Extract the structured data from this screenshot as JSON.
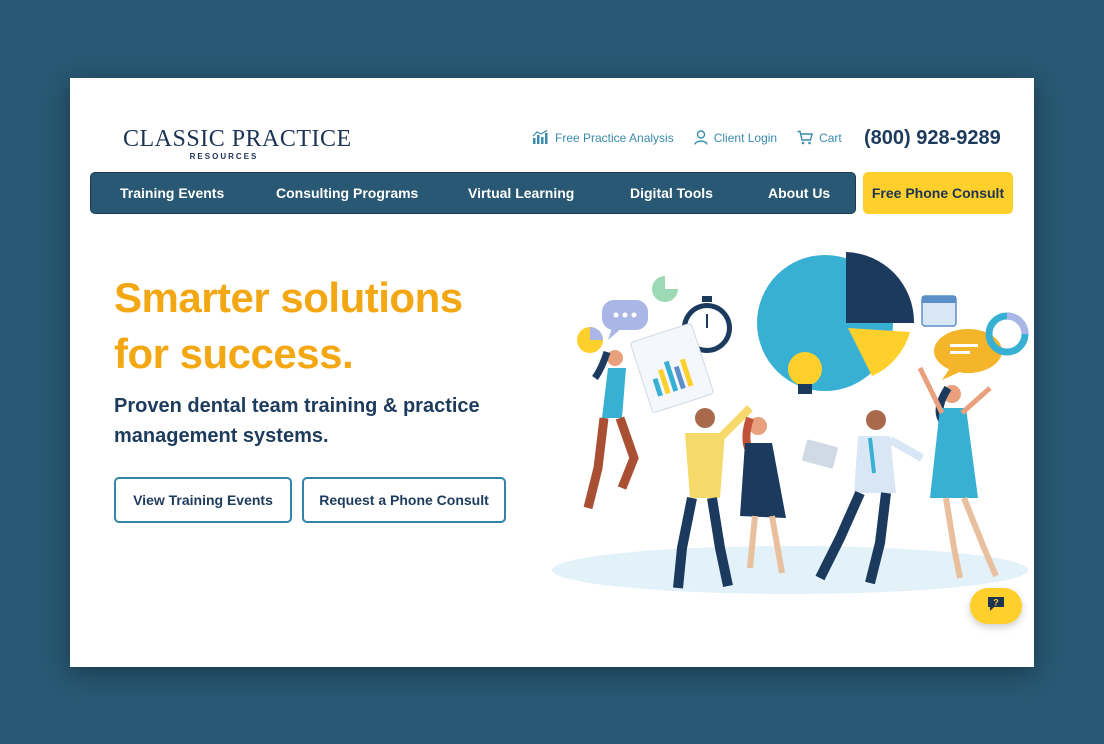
{
  "brand": {
    "name_line1": "CLASSIC PRACTICE",
    "name_line2": "RESOURCES"
  },
  "utility": {
    "analysis": "Free Practice Analysis",
    "login": "Client Login",
    "cart": "Cart",
    "phone": "(800) 928-9289"
  },
  "nav": {
    "items": [
      "Training Events",
      "Consulting Programs",
      "Virtual Learning",
      "Digital Tools",
      "About Us"
    ],
    "cta": "Free Phone Consult"
  },
  "hero": {
    "headline_1": "Smarter solutions",
    "headline_2": "for success.",
    "subhead": "Proven dental team training & practice management systems.",
    "button_1": "View Training Events",
    "button_2": "Request a Phone Consult"
  },
  "colors": {
    "background": "#285873",
    "accent_yellow": "#ffd02b",
    "headline_orange": "#f3a712",
    "navy": "#1d3b5c",
    "link_blue": "#3a8cad"
  },
  "icons": {
    "analysis": "bar-chart-icon",
    "login": "user-icon",
    "cart": "cart-icon",
    "chat": "chat-question-icon"
  }
}
